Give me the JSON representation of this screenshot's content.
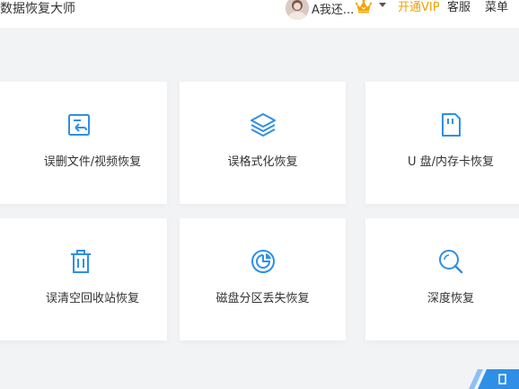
{
  "app": {
    "title": "数据恢复大师"
  },
  "header": {
    "username": "A我还...",
    "vip_label": "开通VIP",
    "service_label": "客服",
    "menu_label": "菜单"
  },
  "features": [
    {
      "label": "误删文件/视频恢复",
      "icon": "file-restore-icon"
    },
    {
      "label": "误格式化恢复",
      "icon": "layers-icon"
    },
    {
      "label": "U 盘/内存卡恢复",
      "icon": "sd-card-icon"
    },
    {
      "label": "误清空回收站恢复",
      "icon": "trash-icon"
    },
    {
      "label": "磁盘分区丢失恢复",
      "icon": "pie-chart-icon"
    },
    {
      "label": "深度恢复",
      "icon": "search-icon"
    }
  ],
  "colors": {
    "accent": "#2f8fe6",
    "vip": "#f0a000",
    "background": "#f2f3f5"
  }
}
